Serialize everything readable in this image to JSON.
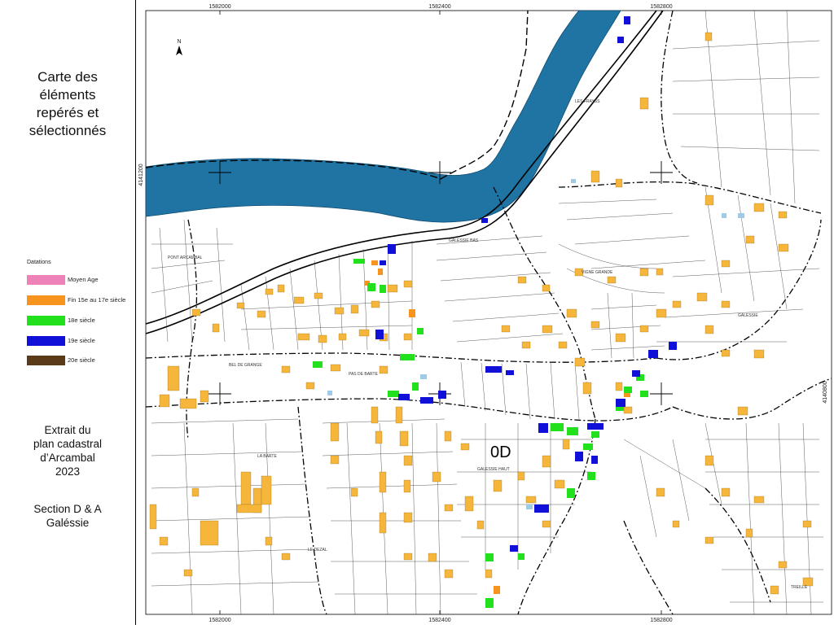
{
  "title_lines": [
    "Carte des",
    "éléments",
    "repérés et",
    "sélectionnés"
  ],
  "legend": {
    "heading": "Datations",
    "items": [
      {
        "label": "Moyen Age",
        "color": "#ee82b8"
      },
      {
        "label": "Fin 15e au 17e siècle",
        "color": "#f7941d"
      },
      {
        "label": "18e siècle",
        "color": "#22e01c"
      },
      {
        "label": "19e siècle",
        "color": "#1010d8"
      },
      {
        "label": "20e siècle",
        "color": "#5b3a17"
      }
    ]
  },
  "extract_lines": [
    "Extrait du",
    "plan cadastral",
    "d’Arcambal",
    "2023"
  ],
  "section_lines": [
    "Section D & A",
    "Galéssie"
  ],
  "map": {
    "top_coords": [
      "1582000",
      "1582400",
      "1582800"
    ],
    "bottom_coords": [
      "1582000",
      "1582400",
      "1582800"
    ],
    "left_coord": "4141200",
    "right_coord": "4140800",
    "section_label": "0D",
    "north_label": "N",
    "place_names": [
      "PONT ARCAMBAL",
      "GALESSIE BAS",
      "VIGNE GRANDE",
      "GALESSIE",
      "PAS DE BARTE",
      "GALESSIE HAUT",
      "LA BARTE",
      "LE DEZAL",
      "LES FRAYSS",
      "BEL DE GRANGE",
      "TREILLE"
    ],
    "colors": {
      "river": "#1f74a3",
      "vernacular": "#f5b63b",
      "c18": "#22e01c",
      "c19": "#1010d8",
      "c17": "#f7941d"
    }
  }
}
